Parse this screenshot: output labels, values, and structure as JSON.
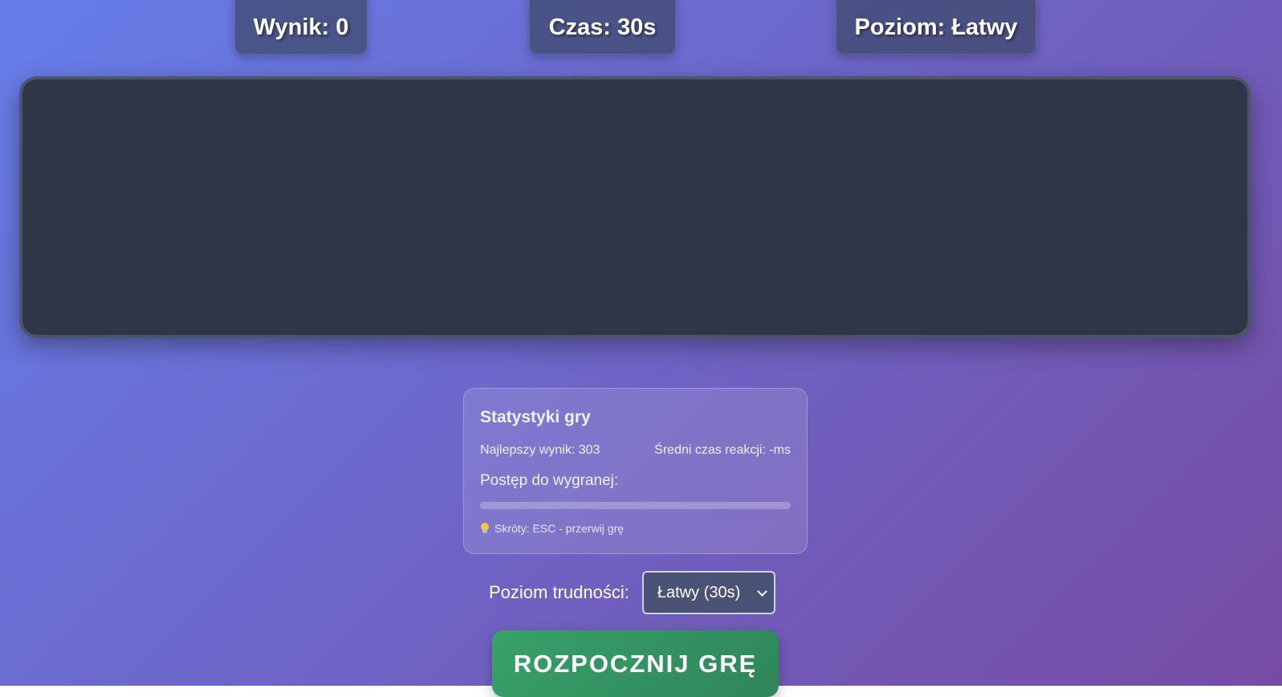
{
  "header": {
    "score": "Wynik: 0",
    "time": "Czas: 30s",
    "level": "Poziom: Łatwy"
  },
  "stats": {
    "title": "Statystyki gry",
    "best_score": "Najlepszy wynik: 303",
    "avg_reaction": "Średni czas reakcji: -ms",
    "progress_label": "Postęp do wygranej:",
    "progress_value": 0,
    "shortcut_hint": "Skróty: ESC - przerwij grę"
  },
  "controls": {
    "difficulty_label": "Poziom trudności:",
    "difficulty_selected": "Łatwy (30s)",
    "start_button": "ROZPOCZNIJ GRĘ"
  },
  "colors": {
    "background_start": "#667eea",
    "background_end": "#764ba2",
    "game_area": "#2d3748",
    "start_button": "#38a169"
  },
  "icons": {
    "shortcut_icon": "lightbulb-icon",
    "select_icon": "chevron-down-icon"
  }
}
